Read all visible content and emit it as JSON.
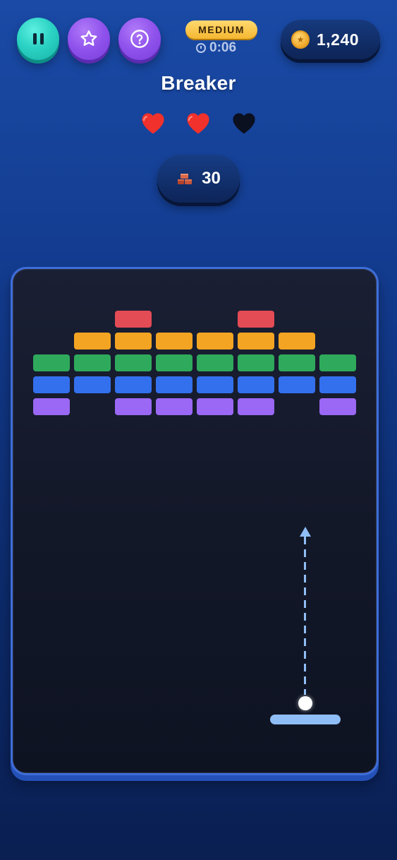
{
  "hud": {
    "pause_icon": "pause-icon",
    "favorite_icon": "star-icon",
    "help_icon": "question-circle-icon",
    "difficulty": "MEDIUM",
    "timer": "0:06",
    "coins": "1,240"
  },
  "game": {
    "title": "Breaker",
    "lives_total": 3,
    "lives_remaining": 2,
    "bricks_remaining": "30"
  },
  "colors": {
    "red": "#e34b55",
    "orange": "#f4a423",
    "green": "#2faa5c",
    "blue": "#3370ee",
    "purple": "#9a68f4",
    "paddle": "#8fbdf5",
    "accent_teal": "#2cd3c4",
    "accent_purple": "#8f52ec",
    "badge_gold": "#f5b731"
  },
  "brick_grid": {
    "columns": 8,
    "rows": [
      [
        "",
        "",
        "red",
        "",
        "",
        "red",
        "",
        ""
      ],
      [
        "",
        "orange",
        "orange",
        "orange",
        "orange",
        "orange",
        "orange",
        ""
      ],
      [
        "green",
        "green",
        "green",
        "green",
        "green",
        "green",
        "green",
        "green"
      ],
      [
        "blue",
        "blue",
        "blue",
        "blue",
        "blue",
        "blue",
        "blue",
        "blue"
      ],
      [
        "purple",
        "",
        "purple",
        "purple",
        "purple",
        "purple",
        "",
        "purple"
      ]
    ]
  }
}
